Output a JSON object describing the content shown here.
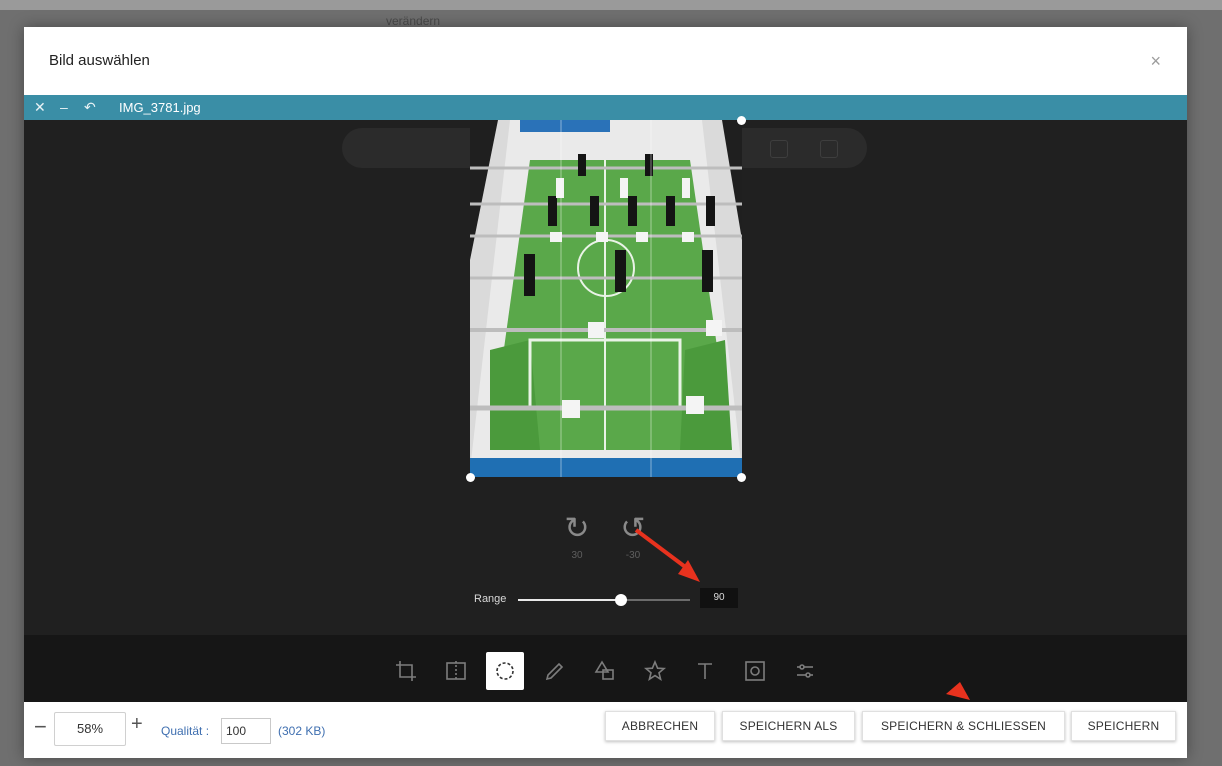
{
  "background": {
    "text": "verändern"
  },
  "dialog": {
    "title": "Bild auswählen",
    "close_icon": "close-icon"
  },
  "file_bar": {
    "filename": "IMG_3781.jpg",
    "icons": [
      "close-icon",
      "minimize-icon",
      "undo-icon"
    ]
  },
  "rotate": {
    "clockwise_label": "30",
    "counterclockwise_label": "-30"
  },
  "range": {
    "label": "Range",
    "value": "90",
    "slider_fraction": 0.6
  },
  "tools": [
    {
      "name": "crop-icon",
      "active": false
    },
    {
      "name": "flip-icon",
      "active": false
    },
    {
      "name": "rotate-icon",
      "active": true
    },
    {
      "name": "draw-icon",
      "active": false
    },
    {
      "name": "shape-icon",
      "active": false
    },
    {
      "name": "star-icon",
      "active": false
    },
    {
      "name": "text-icon",
      "active": false
    },
    {
      "name": "mask-icon",
      "active": false
    },
    {
      "name": "filter-icon",
      "active": false
    }
  ],
  "footer": {
    "zoom": "58%",
    "zoom_minus": "−",
    "zoom_plus": "+",
    "quality_label": "Qualität :",
    "quality_value": "100",
    "file_size": "(302 KB)",
    "buttons": {
      "cancel": "ABBRECHEN",
      "save_as": "SPEICHERN ALS",
      "save_close": "SPEICHERN & SCHLIESSEN",
      "save": "SPEICHERN"
    }
  },
  "colors": {
    "accent_bar": "#3a8ea6",
    "editor_bg": "#202020",
    "annotation_arrow": "#e8321e"
  }
}
